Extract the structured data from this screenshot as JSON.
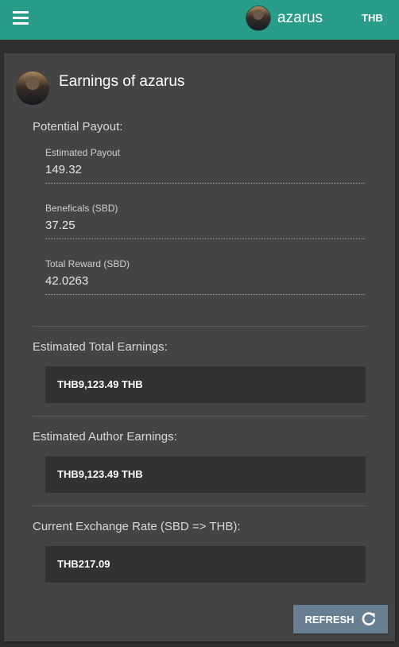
{
  "header": {
    "username": "azarus",
    "currency": "THB"
  },
  "card": {
    "title": "Earnings of azarus",
    "potential_payout": {
      "heading": "Potential Payout:",
      "fields": [
        {
          "label": "Estimated Payout",
          "value": "149.32"
        },
        {
          "label": "Beneficals (SBD)",
          "value": "37.25"
        },
        {
          "label": "Total Reward (SBD)",
          "value": "42.0263"
        }
      ]
    },
    "total_earnings": {
      "heading": "Estimated Total Earnings:",
      "value": "THB9,123.49 THB"
    },
    "author_earnings": {
      "heading": "Estimated Author Earnings:",
      "value": "THB9,123.49 THB"
    },
    "exchange_rate": {
      "heading": "Current Exchange Rate (SBD => THB):",
      "value": "THB217.09"
    },
    "refresh_label": "REFRESH"
  },
  "icons": {
    "menu": "menu-icon",
    "refresh": "refresh-icon"
  }
}
